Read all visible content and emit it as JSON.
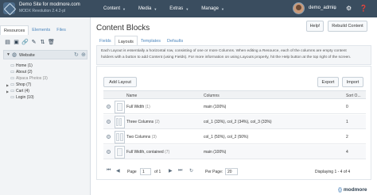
{
  "topbar": {
    "site_title": "Demo Site for modmore.com",
    "site_sub": "MODX Revolution 2.4.2-pl",
    "nav": [
      {
        "label": "Content"
      },
      {
        "label": "Media"
      },
      {
        "label": "Extras"
      },
      {
        "label": "Manage"
      }
    ],
    "username": "demo_admin",
    "icons": [
      "logo-icon",
      "avatar",
      "gear-icon",
      "help-icon"
    ]
  },
  "sidebar": {
    "tabs": [
      {
        "label": "Resources",
        "active": true
      },
      {
        "label": "Elements",
        "active": false
      },
      {
        "label": "Files",
        "active": false
      }
    ],
    "tools": [
      "new-document-icon",
      "new-weblink-icon",
      "new-symlink-icon",
      "new-static-icon",
      "sort-icon",
      "trash-icon"
    ],
    "tree": {
      "root": "Website",
      "items": [
        {
          "label": "Home (1)",
          "expandable": false,
          "dim": false
        },
        {
          "label": "About (2)",
          "expandable": false,
          "dim": false
        },
        {
          "label": "Alpaca Photos (3)",
          "expandable": false,
          "dim": true
        },
        {
          "label": "Shop (7)",
          "expandable": true,
          "dim": false
        },
        {
          "label": "Cart (4)",
          "expandable": true,
          "dim": false
        },
        {
          "label": "Login (10)",
          "expandable": false,
          "dim": false
        }
      ]
    }
  },
  "main": {
    "title": "Content Blocks",
    "help_button": "Help!",
    "rebuild_button": "Rebuild Content",
    "tabs": [
      {
        "label": "Fields",
        "active": false
      },
      {
        "label": "Layouts",
        "active": true
      },
      {
        "label": "Templates",
        "active": false
      },
      {
        "label": "Defaults",
        "active": false
      }
    ],
    "description_line1": "Each Layout is essentially a horizontal row, consisting of one or more Columns. When editing a Resource, each of the columns are empty content",
    "description_line2": "holders with a button to add Content (using Fields). For more information on using Layouts properly, hit the Help button at the top right of the screen.",
    "add_layout_button": "Add Layout",
    "export_button": "Export",
    "import_button": "Import",
    "grid": {
      "headers": [
        "Name",
        "Columns",
        "Sort O..."
      ],
      "rows": [
        {
          "name": "Full Width",
          "count": "(1)",
          "columns": "main (100%)",
          "sort": "0"
        },
        {
          "name": "Three Columns",
          "count": "(2)",
          "columns": "col_1 (33%), col_2 (34%), col_3 (33%)",
          "sort": "1"
        },
        {
          "name": "Two Columns",
          "count": "(3)",
          "columns": "col_1 (50%), col_2 (50%)",
          "sort": "2"
        },
        {
          "name": "Full Width, contained",
          "count": "(7)",
          "columns": "main (100%)",
          "sort": "4"
        }
      ]
    },
    "pager": {
      "page_label": "Page",
      "page_value": "1",
      "of_label": "of 1",
      "per_page_label": "Per Page:",
      "per_page_value": "20",
      "displaying": "Displaying 1 - 4 of 4"
    }
  },
  "brand": {
    "bracket_left": "{",
    "bracket_right": "}",
    "name": "modmore"
  }
}
